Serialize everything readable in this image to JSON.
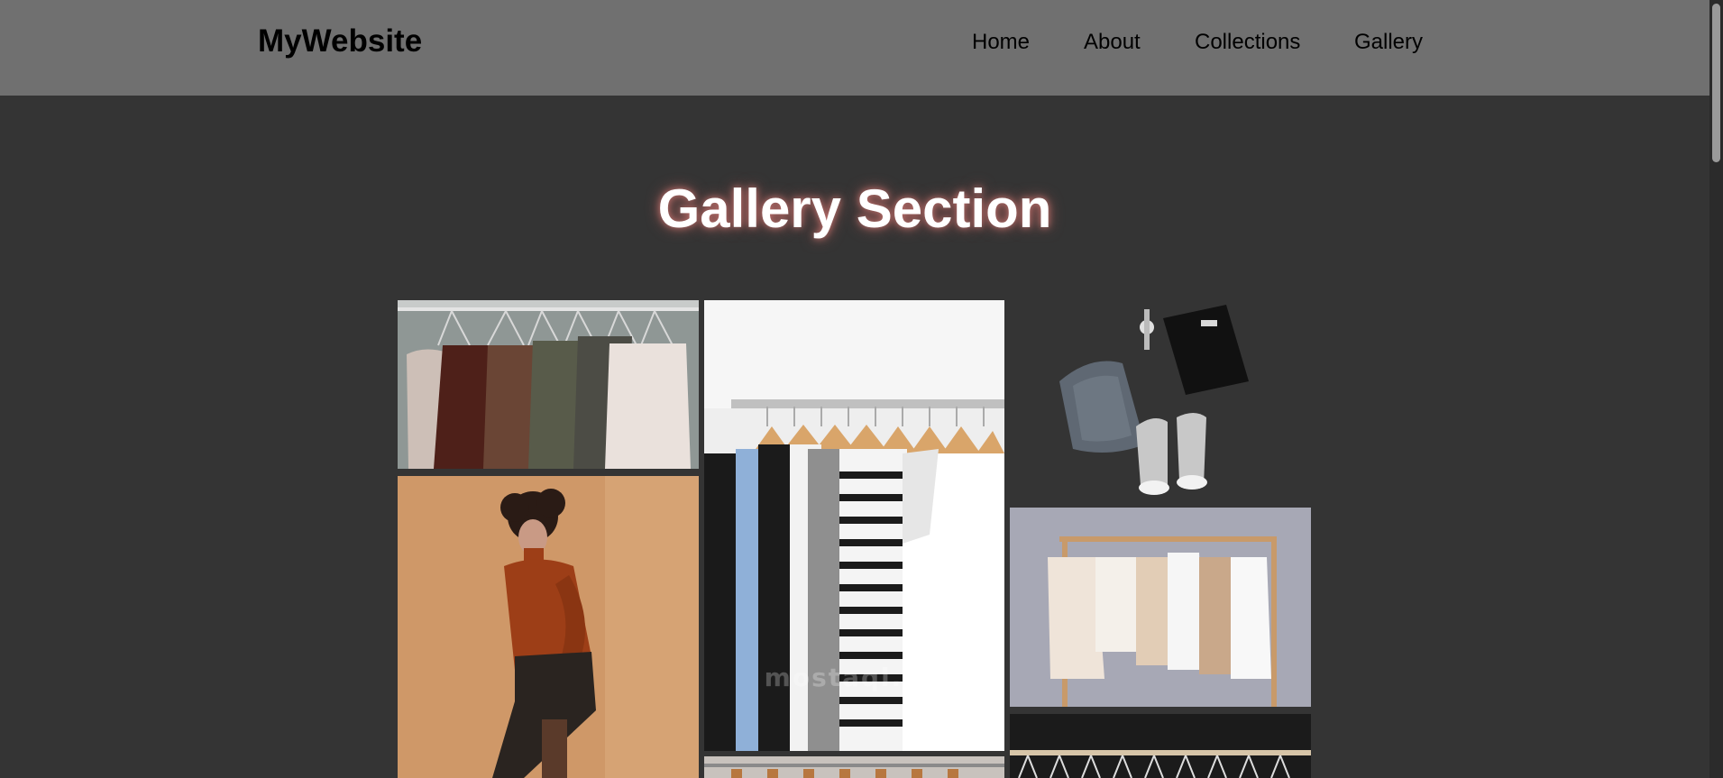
{
  "header": {
    "logo": "MyWebsite",
    "nav": [
      "Home",
      "About",
      "Collections",
      "Gallery"
    ]
  },
  "main": {
    "title": "Gallery Section"
  },
  "gallery": {
    "images": [
      {
        "name": "hanging-jackets-photo"
      },
      {
        "name": "clothing-rack-white-wall-photo"
      },
      {
        "name": "flatlay-jeans-tshirt-sneakers-photo"
      },
      {
        "name": "man-orange-sweater-photo"
      },
      {
        "name": "neutral-clothes-rack-photo"
      },
      {
        "name": "rack-hangers-bottom-photo"
      },
      {
        "name": "black-rack-hangers-photo"
      }
    ],
    "watermark": "mostaql.com"
  },
  "colors": {
    "header_bg": "#707070",
    "page_bg": "#343434",
    "title_glow": "#c2726f"
  }
}
